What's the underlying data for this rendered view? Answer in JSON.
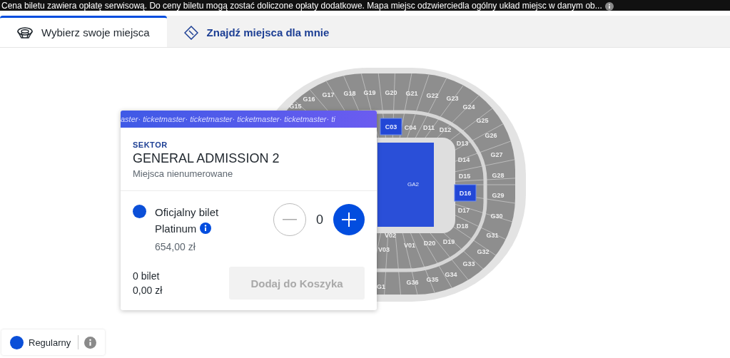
{
  "notice": {
    "text": "Cena biletu zawiera opłatę serwisową. Do ceny biletu mogą zostać doliczone opłaty dodatkowe. Mapa miejsc odzwierciedla ogólny układ miejsc w danym ob..."
  },
  "tabs": [
    {
      "label": "Wybierz swoje miejsca",
      "kind": "stadium",
      "selected": true
    },
    {
      "label": "Znajdź miejsca dla mnie",
      "kind": "ticket",
      "selected": false
    }
  ],
  "map": {
    "field_label": "GA2",
    "sections": [
      {
        "label": "G15",
        "selected": false
      },
      {
        "label": "G16",
        "selected": false
      },
      {
        "label": "G17",
        "selected": false
      },
      {
        "label": "G18",
        "selected": false
      },
      {
        "label": "G19",
        "selected": false
      },
      {
        "label": "G20",
        "selected": false
      },
      {
        "label": "G21",
        "selected": false
      },
      {
        "label": "G22",
        "selected": false
      },
      {
        "label": "G23",
        "selected": false
      },
      {
        "label": "G24",
        "selected": false
      },
      {
        "label": "G25",
        "selected": false
      },
      {
        "label": "G26",
        "selected": false
      },
      {
        "label": "G27",
        "selected": false
      },
      {
        "label": "G28",
        "selected": false
      },
      {
        "label": "G29",
        "selected": false
      },
      {
        "label": "G30",
        "selected": false
      },
      {
        "label": "G31",
        "selected": false
      },
      {
        "label": "G32",
        "selected": false
      },
      {
        "label": "G33",
        "selected": false
      },
      {
        "label": "G34",
        "selected": false
      },
      {
        "label": "G35",
        "selected": false
      },
      {
        "label": "G36",
        "selected": false
      },
      {
        "label": "G1",
        "selected": false
      },
      {
        "label": "C03",
        "selected": true
      },
      {
        "label": "C04",
        "selected": false
      },
      {
        "label": "D11",
        "selected": false
      },
      {
        "label": "D12",
        "selected": false
      },
      {
        "label": "D13",
        "selected": false
      },
      {
        "label": "D14",
        "selected": false
      },
      {
        "label": "D15",
        "selected": false
      },
      {
        "label": "D16",
        "selected": true
      },
      {
        "label": "D17",
        "selected": false
      },
      {
        "label": "D18",
        "selected": false
      },
      {
        "label": "D19",
        "selected": false
      },
      {
        "label": "D20",
        "selected": false
      },
      {
        "label": "V01",
        "selected": false
      },
      {
        "label": "V02",
        "selected": false
      },
      {
        "label": "V03",
        "selected": false
      }
    ]
  },
  "card": {
    "band": "aster· ticketmaster· ticketmaster· ticketmaster· ticketmaster· ti",
    "eyebrow": "SEKTOR",
    "title": "GENERAL ADMISSION 2",
    "subtitle": "Miejsca nienumerowane",
    "ticket": {
      "color": "#0b4fd8",
      "name": "Oficjalny bilet Platinum",
      "price": "654,00 zł",
      "quantity": "0"
    },
    "summary": {
      "count": "0 bilet",
      "total": "0,00 zł"
    },
    "add_button": {
      "label": "Dodaj do Koszyka",
      "disabled": true
    }
  },
  "legend": [
    {
      "label": "Regularny",
      "color": "#0b4fd8"
    }
  ]
}
